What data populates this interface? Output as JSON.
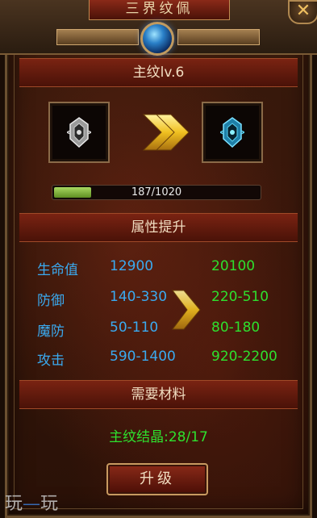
{
  "window": {
    "title": "三界纹佩",
    "close_label": "✕"
  },
  "rune": {
    "header": "主纹lv.6",
    "progress_text": "187/1020",
    "progress": 0.183
  },
  "attributes": {
    "header": "属性提升",
    "rows": [
      {
        "name": "生命值",
        "current": "12900",
        "next": "20100"
      },
      {
        "name": "防御",
        "current": "140-330",
        "next": "220-510"
      },
      {
        "name": "魔防",
        "current": "50-110",
        "next": "80-180"
      },
      {
        "name": "攻击",
        "current": "590-1400",
        "next": "920-2200"
      }
    ]
  },
  "materials": {
    "header": "需要材料",
    "item": "主纹结晶:28/17"
  },
  "upgrade_label": "升级",
  "watermark": {
    "left": "玩",
    "right": "玩"
  },
  "colors": {
    "current_stat": "#3aaaf0",
    "next_stat": "#2ee02e",
    "progress_fill": "#8cc040",
    "arrow": "#f0c020"
  },
  "icons": {
    "current_rune": "rune-gray-icon",
    "next_rune": "rune-blue-icon",
    "arrow": "double-arrow-right-icon"
  }
}
